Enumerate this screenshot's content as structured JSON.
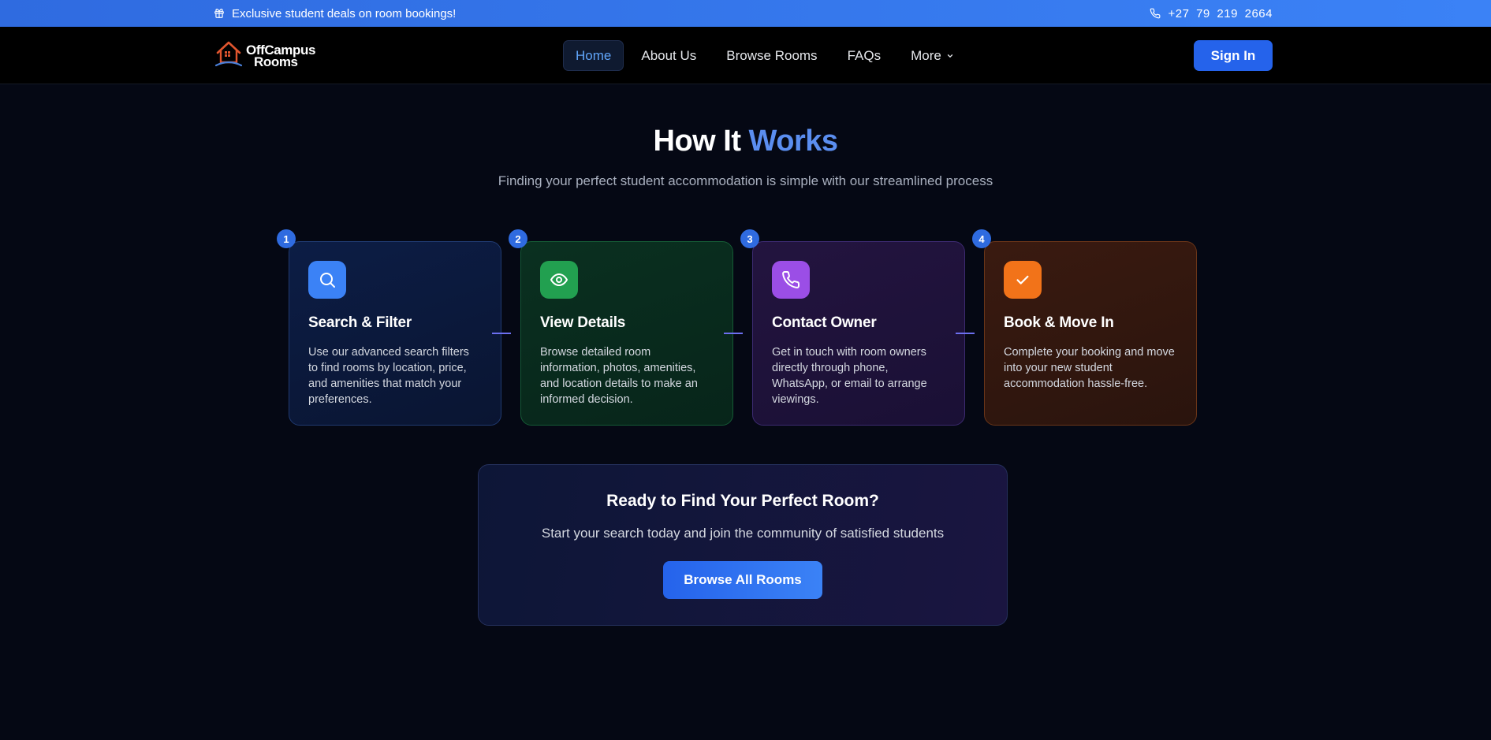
{
  "promo": {
    "text": "Exclusive student deals on room bookings!",
    "phone": "+27 79 219 2664",
    "gift_icon": "gift-icon",
    "phone_icon": "phone-icon"
  },
  "nav": {
    "logo_line1": "OffCampus",
    "logo_line2": "Rooms",
    "links": [
      {
        "label": "Home",
        "active": true
      },
      {
        "label": "About Us"
      },
      {
        "label": "Browse Rooms"
      },
      {
        "label": "FAQs"
      },
      {
        "label": "More"
      }
    ],
    "signin": "Sign In"
  },
  "hero": {
    "title_plain": "How It",
    "title_accent": "Works",
    "subtitle": "Finding your perfect student accommodation is simple with our streamlined process"
  },
  "steps": [
    {
      "number": "1",
      "icon": "search-icon",
      "title": "Search & Filter",
      "description": "Use our advanced search filters to find rooms by location, price, and amenities that match your preferences."
    },
    {
      "number": "2",
      "icon": "eye-icon",
      "title": "View Details",
      "description": "Browse detailed room information, photos, amenities, and location details to make an informed decision."
    },
    {
      "number": "3",
      "icon": "phone-icon",
      "title": "Contact Owner",
      "description": "Get in touch with room owners directly through phone, WhatsApp, or email to arrange viewings."
    },
    {
      "number": "4",
      "icon": "check-icon",
      "title": "Book & Move In",
      "description": "Complete your booking and move into your new student accommodation hassle-free."
    }
  ],
  "cta": {
    "title": "Ready to Find Your Perfect Room?",
    "subtitle": "Start your search today and join the community of satisfied students",
    "button": "Browse All Rooms"
  },
  "colors": {
    "accent": "#3b82f6",
    "step1": "#3b82f6",
    "step2": "#22a050",
    "step3": "#9b4ee6",
    "step4": "#f27319"
  }
}
